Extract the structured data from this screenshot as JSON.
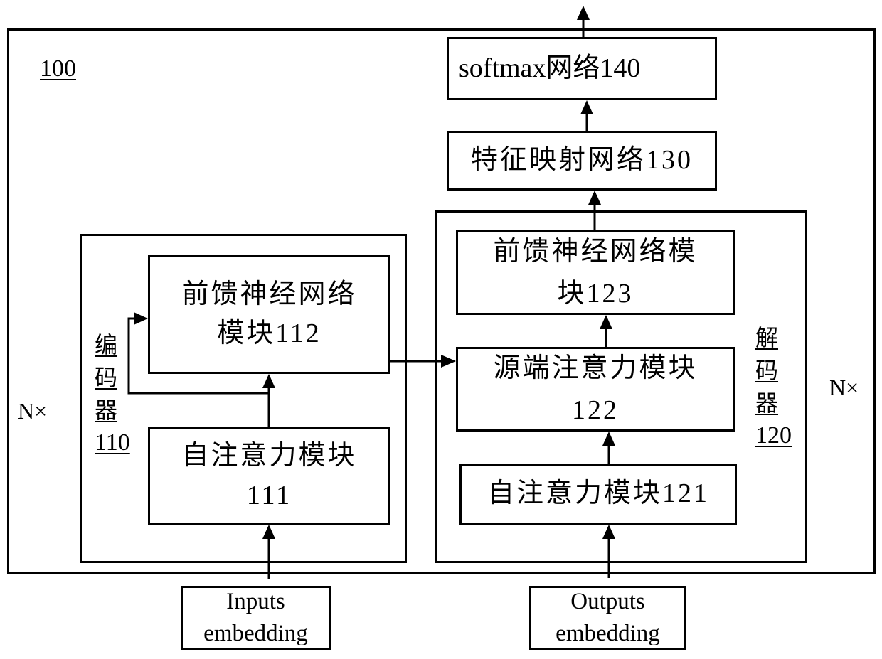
{
  "diagram": {
    "system_id": "100",
    "repeat_label": "N×",
    "encoder": {
      "label_chars": [
        "编",
        "码",
        "器"
      ],
      "id": "110",
      "feedforward": {
        "line1": "前馈神经网络",
        "line2": "模块112"
      },
      "self_attention": {
        "line1": "自注意力模块",
        "line2": "111"
      }
    },
    "decoder": {
      "label_chars": [
        "解",
        "码",
        "器"
      ],
      "id": "120",
      "feedforward": {
        "line1": "前馈神经网络模",
        "line2": "块123"
      },
      "source_attention": {
        "line1": "源端注意力模块",
        "line2": "122"
      },
      "self_attention": {
        "line1": "自注意力模块121"
      }
    },
    "feature_mapping": "特征映射网络130",
    "softmax": "softmax网络140",
    "inputs_embedding": {
      "line1": "Inputs",
      "line2": "embedding"
    },
    "outputs_embedding": {
      "line1": "Outputs",
      "line2": "embedding"
    }
  }
}
